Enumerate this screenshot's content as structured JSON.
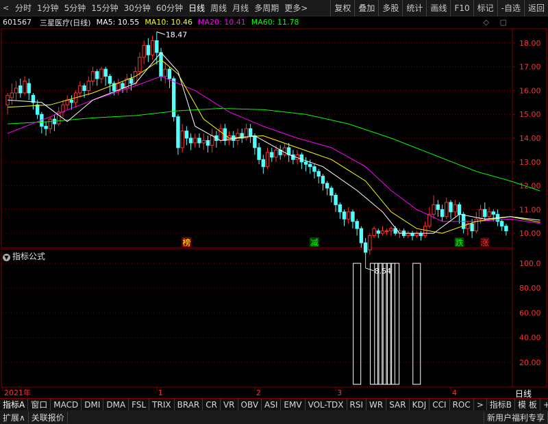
{
  "toolbar": {
    "back_label": "<",
    "timeframes": [
      "分时",
      "1分钟",
      "5分钟",
      "15分钟",
      "30分钟",
      "60分钟",
      "日线",
      "周线",
      "月线",
      "多周期"
    ],
    "active_timeframe": "日线",
    "more_label": "更多>",
    "tools": [
      "复权",
      "叠加",
      "多股",
      "统计",
      "画线",
      "F10",
      "标记",
      "-自选",
      "返回"
    ]
  },
  "stock": {
    "code": "601567",
    "name": "三星医疗(日线)"
  },
  "ma": {
    "ma5": "MA5: 10.55",
    "ma10": "MA10: 10.46",
    "ma20": "MA20: 10.41",
    "ma60": "MA60: 11.78"
  },
  "panel_icons": "◇ ▢",
  "colors": {
    "up": "#ff3232",
    "down": "#54ffff",
    "ma5": "#ffffff",
    "ma10": "#ffff00",
    "ma20": "#ff00ff",
    "ma60": "#00ff00",
    "grid": "#800000"
  },
  "chart_data": {
    "type": "candlestick",
    "y_ticks": [
      "18.00",
      "17.00",
      "16.00",
      "15.00",
      "14.00",
      "13.00",
      "12.00",
      "11.00",
      "10.00"
    ],
    "ylim": [
      9.4,
      18.6
    ],
    "high_label": "18.47",
    "low_label": "8.54",
    "x_ticks": [
      {
        "label": "2021年",
        "index": 0
      },
      {
        "label": "1",
        "index": 35
      },
      {
        "label": "2",
        "index": 58
      },
      {
        "label": "3",
        "index": 77
      },
      {
        "label": "4",
        "index": 104
      }
    ],
    "candles": [
      [
        15.4,
        15.8,
        15.0,
        15.9
      ],
      [
        15.7,
        15.9,
        15.4,
        16.3
      ],
      [
        15.9,
        16.1,
        15.6,
        16.4
      ],
      [
        16.2,
        15.9,
        15.7,
        16.5
      ],
      [
        15.9,
        16.4,
        15.8,
        16.6
      ],
      [
        16.3,
        15.9,
        15.6,
        16.5
      ],
      [
        15.8,
        15.5,
        15.2,
        15.9
      ],
      [
        15.4,
        15.0,
        14.8,
        15.6
      ],
      [
        15.0,
        14.5,
        14.2,
        15.1
      ],
      [
        14.5,
        14.4,
        14.1,
        14.7
      ],
      [
        14.4,
        14.8,
        14.2,
        14.9
      ],
      [
        14.8,
        14.6,
        14.3,
        15.0
      ],
      [
        14.6,
        15.1,
        14.5,
        15.3
      ],
      [
        15.1,
        15.4,
        14.9,
        15.6
      ],
      [
        15.4,
        15.6,
        15.2,
        15.8
      ],
      [
        15.6,
        15.5,
        15.2,
        15.8
      ],
      [
        15.5,
        15.9,
        15.3,
        16.0
      ],
      [
        15.9,
        16.2,
        15.7,
        16.4
      ],
      [
        16.2,
        16.0,
        15.7,
        16.3
      ],
      [
        16.0,
        16.4,
        15.8,
        16.6
      ],
      [
        16.4,
        16.8,
        16.2,
        17.0
      ],
      [
        16.8,
        16.5,
        16.2,
        16.9
      ],
      [
        16.5,
        16.9,
        16.3,
        17.0
      ],
      [
        16.9,
        16.6,
        16.2,
        17.0
      ],
      [
        16.6,
        16.3,
        15.9,
        16.7
      ],
      [
        16.3,
        16.0,
        15.8,
        16.4
      ],
      [
        16.0,
        16.3,
        15.8,
        16.5
      ],
      [
        16.3,
        16.1,
        15.9,
        16.4
      ],
      [
        16.1,
        16.5,
        15.9,
        16.7
      ],
      [
        16.5,
        16.3,
        16.0,
        16.7
      ],
      [
        16.3,
        16.8,
        16.2,
        17.0
      ],
      [
        16.8,
        17.4,
        16.6,
        17.6
      ],
      [
        17.4,
        17.9,
        17.1,
        18.1
      ],
      [
        17.9,
        17.5,
        17.2,
        18.2
      ],
      [
        17.5,
        18.1,
        17.3,
        18.3
      ],
      [
        18.1,
        17.6,
        17.1,
        18.47
      ],
      [
        17.6,
        16.6,
        16.4,
        17.8
      ],
      [
        16.6,
        16.9,
        16.3,
        17.2
      ],
      [
        16.9,
        16.5,
        16.1,
        17.0
      ],
      [
        16.5,
        14.9,
        14.7,
        16.6
      ],
      [
        14.9,
        13.6,
        13.3,
        15.0
      ],
      [
        13.6,
        14.3,
        13.4,
        14.6
      ],
      [
        14.3,
        14.0,
        13.7,
        14.5
      ],
      [
        14.0,
        13.8,
        13.5,
        14.2
      ],
      [
        13.8,
        14.0,
        13.6,
        14.2
      ],
      [
        14.0,
        13.8,
        13.6,
        14.2
      ],
      [
        13.8,
        13.9,
        13.5,
        14.2
      ],
      [
        13.9,
        13.7,
        13.4,
        14.1
      ],
      [
        13.7,
        14.1,
        13.4,
        14.4
      ],
      [
        14.1,
        13.9,
        13.6,
        14.3
      ],
      [
        13.9,
        14.4,
        13.8,
        14.6
      ],
      [
        14.4,
        13.9,
        13.7,
        14.6
      ],
      [
        13.9,
        14.1,
        13.7,
        14.3
      ],
      [
        14.1,
        13.9,
        13.6,
        14.3
      ],
      [
        13.9,
        14.2,
        13.7,
        14.4
      ],
      [
        14.2,
        14.0,
        13.8,
        14.4
      ],
      [
        14.0,
        14.4,
        13.9,
        14.6
      ],
      [
        14.4,
        14.1,
        13.8,
        14.6
      ],
      [
        14.1,
        13.6,
        13.3,
        14.2
      ],
      [
        13.6,
        13.1,
        12.9,
        13.8
      ],
      [
        13.1,
        12.8,
        12.5,
        13.3
      ],
      [
        12.8,
        13.4,
        12.7,
        13.6
      ],
      [
        13.4,
        13.2,
        13.0,
        13.6
      ],
      [
        13.2,
        13.5,
        13.0,
        13.7
      ],
      [
        13.5,
        13.3,
        13.1,
        13.7
      ],
      [
        13.3,
        13.6,
        13.2,
        13.8
      ],
      [
        13.6,
        13.3,
        13.0,
        13.8
      ],
      [
        13.3,
        13.1,
        12.9,
        13.5
      ],
      [
        13.1,
        13.3,
        12.9,
        13.5
      ],
      [
        13.3,
        13.0,
        12.7,
        13.4
      ],
      [
        13.0,
        12.9,
        12.6,
        13.2
      ],
      [
        12.9,
        12.8,
        12.5,
        13.1
      ],
      [
        12.8,
        12.6,
        12.3,
        12.9
      ],
      [
        12.6,
        12.4,
        12.1,
        12.7
      ],
      [
        12.4,
        12.1,
        11.8,
        12.5
      ],
      [
        12.1,
        11.9,
        11.6,
        12.2
      ],
      [
        11.9,
        11.6,
        11.3,
        12.0
      ],
      [
        11.6,
        11.2,
        10.9,
        11.7
      ],
      [
        11.2,
        10.9,
        10.6,
        11.3
      ],
      [
        10.9,
        10.6,
        10.3,
        11.0
      ],
      [
        10.6,
        10.9,
        10.4,
        11.1
      ],
      [
        10.9,
        10.5,
        10.2,
        11.0
      ],
      [
        10.5,
        10.2,
        9.9,
        10.6
      ],
      [
        10.2,
        9.6,
        9.4,
        10.3
      ],
      [
        9.6,
        9.2,
        8.54,
        9.8
      ],
      [
        9.3,
        9.9,
        9.1,
        10.0
      ],
      [
        9.9,
        10.2,
        9.8,
        10.3
      ],
      [
        10.1,
        10.0,
        9.8,
        10.2
      ],
      [
        10.0,
        10.1,
        9.9,
        10.3
      ],
      [
        10.1,
        10.1,
        9.9,
        10.2
      ],
      [
        10.1,
        10.2,
        9.9,
        10.3
      ],
      [
        10.2,
        10.0,
        9.9,
        10.3
      ],
      [
        10.0,
        10.1,
        9.8,
        10.2
      ],
      [
        10.1,
        9.9,
        9.8,
        10.2
      ],
      [
        9.9,
        10.0,
        9.8,
        10.1
      ],
      [
        10.0,
        9.9,
        9.7,
        10.1
      ],
      [
        9.9,
        10.0,
        9.8,
        10.1
      ],
      [
        10.0,
        9.9,
        9.7,
        10.1
      ],
      [
        9.9,
        10.3,
        9.8,
        10.5
      ],
      [
        10.3,
        10.8,
        10.2,
        11.1
      ],
      [
        10.8,
        11.2,
        10.6,
        11.6
      ],
      [
        11.2,
        11.0,
        10.7,
        11.4
      ],
      [
        11.0,
        10.7,
        10.5,
        11.2
      ],
      [
        10.7,
        11.3,
        10.6,
        11.5
      ],
      [
        11.3,
        10.9,
        10.6,
        11.4
      ],
      [
        10.9,
        11.2,
        10.7,
        11.4
      ],
      [
        11.2,
        10.8,
        10.4,
        11.3
      ],
      [
        10.8,
        10.2,
        10.0,
        10.9
      ],
      [
        10.2,
        10.4,
        9.9,
        10.5
      ],
      [
        10.4,
        10.1,
        9.8,
        10.6
      ],
      [
        10.1,
        10.6,
        10.0,
        10.9
      ],
      [
        10.6,
        11.0,
        10.4,
        11.2
      ],
      [
        11.0,
        10.7,
        10.5,
        11.3
      ],
      [
        10.7,
        10.9,
        10.6,
        11.1
      ],
      [
        10.9,
        10.8,
        10.5,
        11.0
      ],
      [
        10.8,
        10.5,
        10.3,
        11.0
      ],
      [
        10.5,
        10.3,
        10.1,
        10.6
      ],
      [
        10.3,
        10.1,
        9.9,
        10.4
      ]
    ],
    "ma60": [
      [
        0,
        14.6
      ],
      [
        10,
        14.7
      ],
      [
        20,
        14.85
      ],
      [
        30,
        14.95
      ],
      [
        40,
        15.15
      ],
      [
        50,
        15.25
      ],
      [
        60,
        15.2
      ],
      [
        70,
        15.0
      ],
      [
        80,
        14.6
      ],
      [
        90,
        14.0
      ],
      [
        100,
        13.3
      ],
      [
        110,
        12.6
      ],
      [
        118,
        12.2
      ],
      [
        125,
        11.78
      ]
    ],
    "ma20": [
      [
        0,
        14.2
      ],
      [
        10,
        14.9
      ],
      [
        20,
        15.6
      ],
      [
        30,
        16.2
      ],
      [
        36,
        16.6
      ],
      [
        44,
        16.0
      ],
      [
        52,
        15.1
      ],
      [
        60,
        14.5
      ],
      [
        68,
        14.0
      ],
      [
        76,
        13.6
      ],
      [
        84,
        12.8
      ],
      [
        90,
        11.8
      ],
      [
        96,
        11.0
      ],
      [
        102,
        10.5
      ],
      [
        110,
        10.5
      ],
      [
        118,
        10.6
      ],
      [
        125,
        10.41
      ]
    ],
    "ma10": [
      [
        0,
        15.3
      ],
      [
        10,
        15.4
      ],
      [
        20,
        15.9
      ],
      [
        30,
        16.6
      ],
      [
        36,
        17.3
      ],
      [
        40,
        16.7
      ],
      [
        46,
        14.8
      ],
      [
        52,
        14.0
      ],
      [
        60,
        14.1
      ],
      [
        68,
        13.6
      ],
      [
        76,
        13.1
      ],
      [
        84,
        12.2
      ],
      [
        90,
        10.9
      ],
      [
        96,
        10.2
      ],
      [
        102,
        10.0
      ],
      [
        110,
        10.5
      ],
      [
        118,
        10.7
      ],
      [
        125,
        10.46
      ]
    ],
    "ma5": [
      [
        0,
        15.6
      ],
      [
        8,
        15.5
      ],
      [
        14,
        14.7
      ],
      [
        20,
        15.6
      ],
      [
        30,
        16.3
      ],
      [
        36,
        17.6
      ],
      [
        40,
        16.8
      ],
      [
        44,
        14.5
      ],
      [
        50,
        13.9
      ],
      [
        58,
        14.1
      ],
      [
        66,
        13.3
      ],
      [
        74,
        12.8
      ],
      [
        82,
        11.8
      ],
      [
        88,
        10.9
      ],
      [
        92,
        10.0
      ],
      [
        100,
        10.0
      ],
      [
        106,
        10.8
      ],
      [
        112,
        10.6
      ],
      [
        118,
        10.7
      ],
      [
        125,
        10.55
      ]
    ],
    "signals": [
      {
        "label": "榜",
        "index": 42,
        "color": "#ffff00",
        "bg": "#800000"
      },
      {
        "label": "减",
        "index": 72,
        "color": "#00ff00",
        "bg": "#004000"
      },
      {
        "label": "跌",
        "index": 106,
        "color": "#00ff00",
        "bg": "#004000"
      },
      {
        "label": "涨",
        "index": 112,
        "color": "#ff3232",
        "bg": "#400000"
      }
    ]
  },
  "indicator": {
    "title": "指标公式",
    "y_ticks": [
      "100.0",
      "80.00",
      "60.00",
      "40.00",
      "20.00"
    ],
    "ylim": [
      0,
      105
    ],
    "bars": [
      {
        "index": 82,
        "value": 100
      },
      {
        "index": 86,
        "value": 100
      },
      {
        "index": 87,
        "value": 100
      },
      {
        "index": 88,
        "value": 100
      },
      {
        "index": 89,
        "value": 100
      },
      {
        "index": 90,
        "value": 100
      },
      {
        "index": 91,
        "value": 100
      },
      {
        "index": 96,
        "value": 100
      }
    ]
  },
  "bottom_tabs": [
    "指标A",
    "窗口",
    "MACD",
    "DMI",
    "DMA",
    "FSL",
    "TRIX",
    "BRAR",
    "CR",
    "VR",
    "OBV",
    "ASI",
    "EMV",
    "VOL-TDX",
    "RSI",
    "WR",
    "SAR",
    "KDJ",
    "CCI",
    "ROC",
    ">",
    "指标B",
    "模 板",
    "+",
    "-"
  ],
  "day_label": "日线",
  "status": {
    "expand": "扩展∧",
    "quote": "关联报价",
    "promo": "新用户福利专享"
  }
}
